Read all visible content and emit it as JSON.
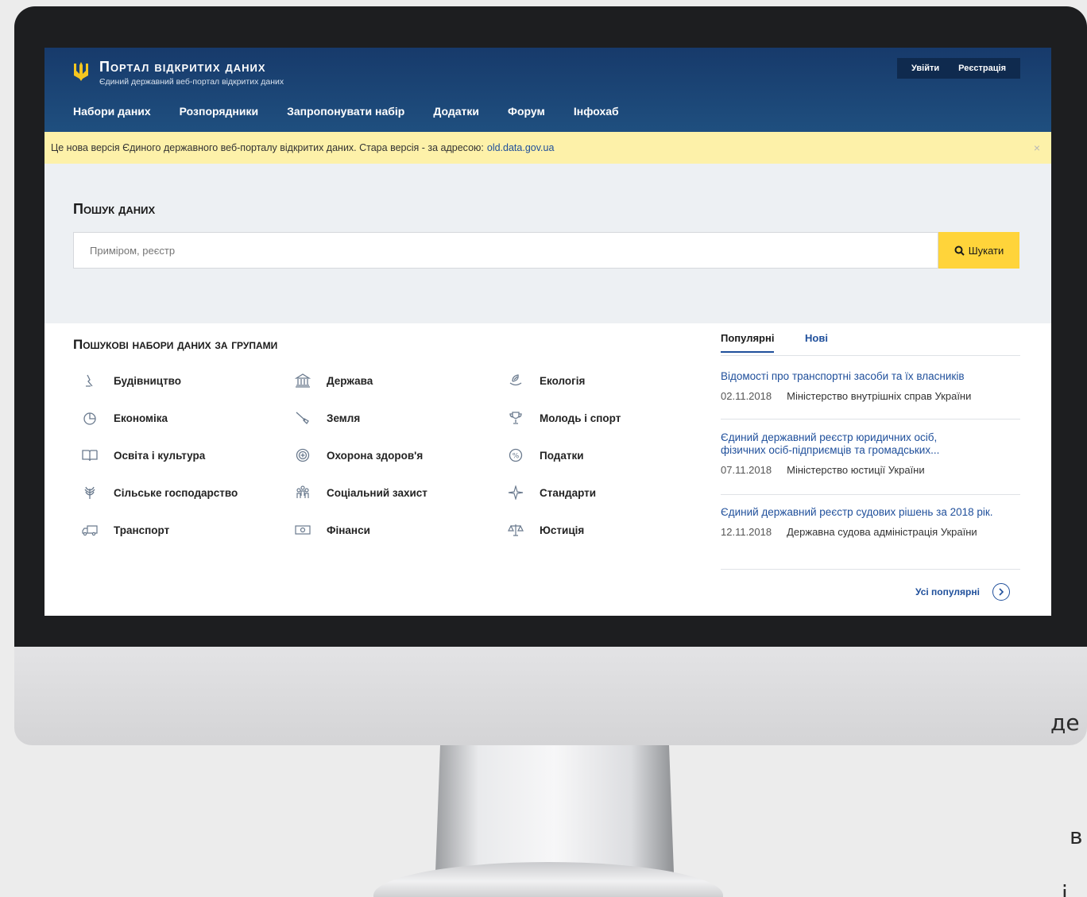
{
  "header": {
    "title": "Портал відкритих даних",
    "subtitle": "Єдиний державний веб-портал відкритих даних",
    "login": "Увійти",
    "register": "Реєстрація",
    "nav": [
      "Набори даних",
      "Розпорядники",
      "Запропонувати набір",
      "Додатки",
      "Форум",
      "Інфохаб"
    ]
  },
  "notice": {
    "text": "Це нова версія Єдиного державного веб-порталу відкритих даних. Стара версія - за адресою:",
    "link": "old.data.gov.ua",
    "close": "×"
  },
  "search": {
    "title": "Пошук даних",
    "placeholder": "Приміром, реєстр",
    "button": "Шукати"
  },
  "groups": {
    "title": "Пошукові набори даних за групами",
    "items": [
      {
        "label": "Будівництво",
        "icon": "construction-icon"
      },
      {
        "label": "Держава",
        "icon": "government-building-icon"
      },
      {
        "label": "Екологія",
        "icon": "ecology-icon"
      },
      {
        "label": "Економіка",
        "icon": "pie-chart-icon"
      },
      {
        "label": "Земля",
        "icon": "shovel-icon"
      },
      {
        "label": "Молодь і спорт",
        "icon": "trophy-icon"
      },
      {
        "label": "Освіта і культура",
        "icon": "book-icon"
      },
      {
        "label": "Охорона здоров'я",
        "icon": "health-icon"
      },
      {
        "label": "Податки",
        "icon": "percent-icon"
      },
      {
        "label": "Сільське господарство",
        "icon": "wheat-icon"
      },
      {
        "label": "Соціальний захист",
        "icon": "people-icon"
      },
      {
        "label": "Стандарти",
        "icon": "standards-icon"
      },
      {
        "label": "Транспорт",
        "icon": "truck-icon"
      },
      {
        "label": "Фінанси",
        "icon": "money-icon"
      },
      {
        "label": "Юстиція",
        "icon": "scales-icon"
      }
    ]
  },
  "tabs": {
    "popular": "Популярні",
    "new": "Нові"
  },
  "news": [
    {
      "title": "Відомості про транспортні засоби та їх власників",
      "date": "02.11.2018",
      "org": "Міністерство внутрішніх справ України"
    },
    {
      "title": "Єдиний державний реєстр юридичних осіб, фізичних осіб-підприємців та громадських...",
      "date": "07.11.2018",
      "org": "Міністерство юстиції України"
    },
    {
      "title": "Єдиний державний реєстр судових рішень за 2018 рік.",
      "date": "12.11.2018",
      "org": "Державна судова адміністрація України"
    }
  ],
  "all_popular": "Усі популярні",
  "side_text": [
    "де",
    "в",
    "і"
  ],
  "colors": {
    "header": "#1f4f7f",
    "accent": "#ffd43a",
    "link": "#1f4f9b",
    "notice": "#fdf1a9"
  }
}
